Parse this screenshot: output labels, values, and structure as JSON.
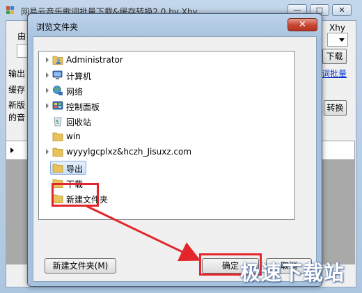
{
  "background_window": {
    "title": "网易云音乐歌词批量下载&缓存转换2.0 by Xhy",
    "title_right_fragment": "Xhy",
    "label_fragments": [
      "由",
      "输出",
      "缓存",
      "新版",
      "的音"
    ],
    "download_button": "下载",
    "link_fragment": "词批量",
    "convert_button": "转换"
  },
  "dialog": {
    "title": "浏览文件夹",
    "close_glyph": "✕",
    "tree_items": [
      {
        "label": "Administrator",
        "icon": "user-folder-icon",
        "expandable": true
      },
      {
        "label": "计算机",
        "icon": "computer-icon",
        "expandable": true
      },
      {
        "label": "网络",
        "icon": "network-icon",
        "expandable": true
      },
      {
        "label": "控制面板",
        "icon": "control-panel-icon",
        "expandable": true
      },
      {
        "label": "回收站",
        "icon": "recycle-bin-icon",
        "expandable": false
      },
      {
        "label": "win",
        "icon": "folder-icon",
        "expandable": false
      },
      {
        "label": "wyyylgcplxz&hczh_Jisuxz.com",
        "icon": "folder-icon",
        "expandable": true
      },
      {
        "label": "导出",
        "icon": "folder-icon",
        "expandable": false,
        "selected": true
      },
      {
        "label": "下载",
        "icon": "folder-icon",
        "expandable": false
      },
      {
        "label": "新建文件夹",
        "icon": "folder-icon",
        "expandable": false
      }
    ],
    "new_folder_button": "新建文件夹(M)",
    "ok_button": "确定",
    "cancel_button": "取消"
  },
  "watermark": "极速下载站",
  "colors": {
    "highlight": "#e2262b",
    "selection": "#c9e1f9",
    "folder": "#e8c35a"
  }
}
